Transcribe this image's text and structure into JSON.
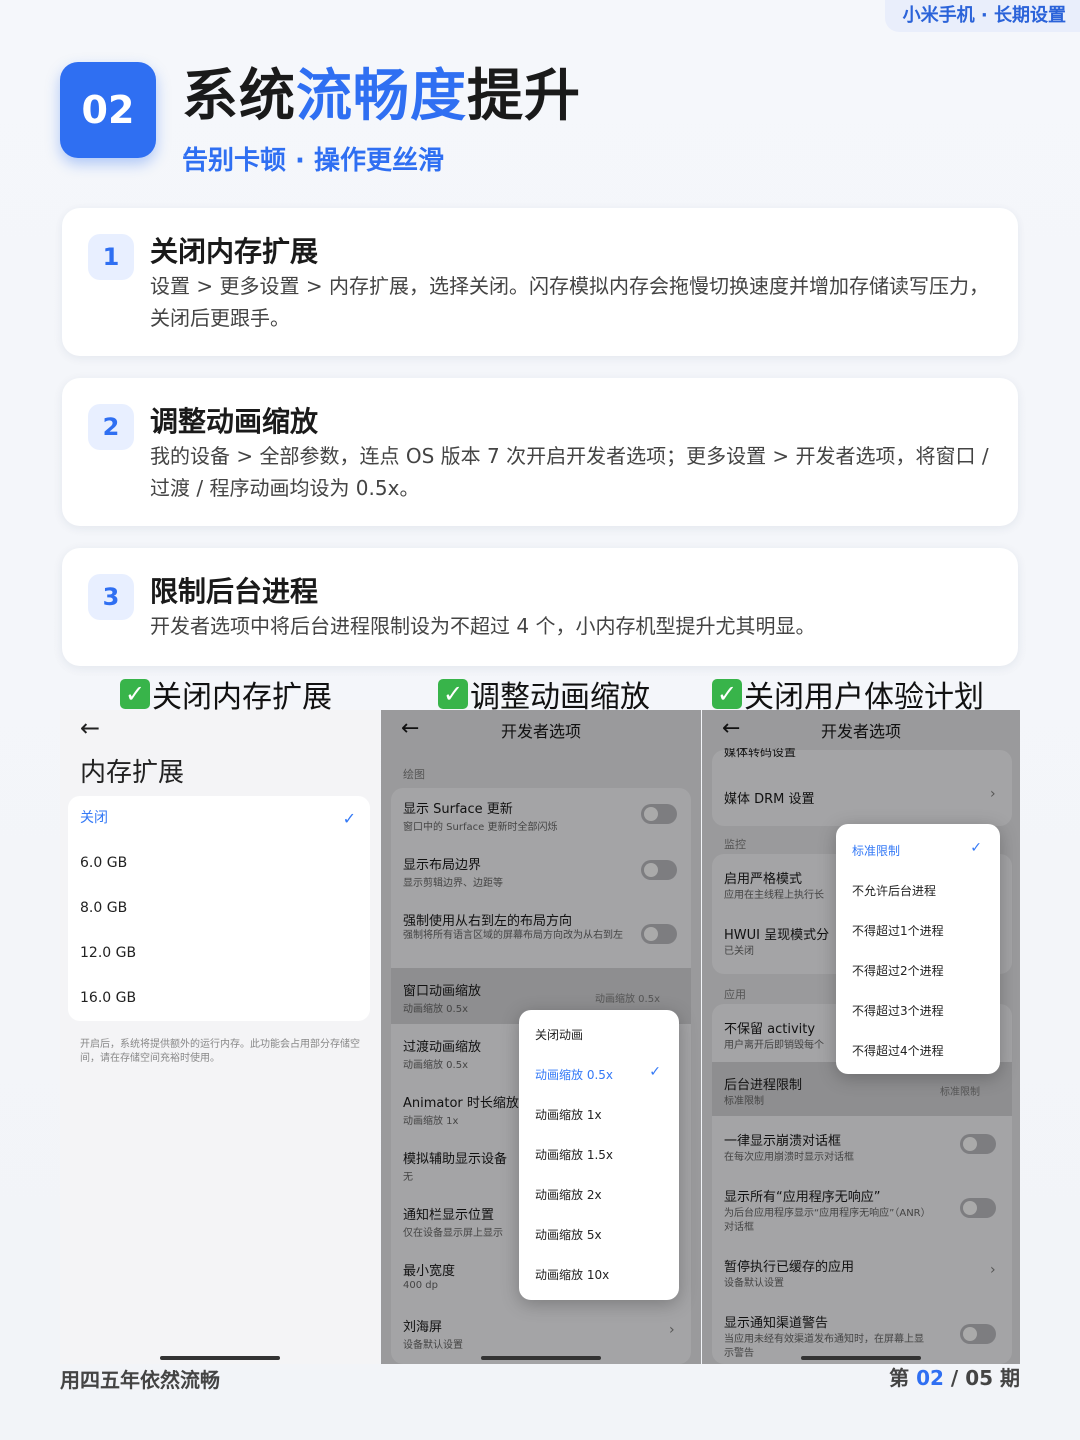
{
  "header": {
    "tag": "小米手机 · 长期设置",
    "badge": "02",
    "title_a": "系统",
    "title_hl": "流畅度",
    "title_b": "提升",
    "subtitle": "告别卡顿 · 操作更丝滑"
  },
  "steps": [
    {
      "num": "1",
      "title": "关闭内存扩展",
      "desc": "设置 > 更多设置 > 内存扩展，选择关闭。闪存模拟内存会拖慢切换速度并增加存储读写压力，关闭后更跟手。"
    },
    {
      "num": "2",
      "title": "调整动画缩放",
      "desc": "我的设备 > 全部参数，连点 OS 版本 7 次开启开发者选项；更多设置 > 开发者选项，将窗口 / 过渡 / 程序动画均设为 0.5x。"
    },
    {
      "num": "3",
      "title": "限制后台进程",
      "desc": "开发者选项中将后台进程限制设为不超过 4 个，小内存机型提升尤其明显。"
    }
  ],
  "captions": [
    "关闭内存扩展",
    "调整动画缩放",
    "关闭用户体验计划"
  ],
  "shot1": {
    "back": "←",
    "title": "内存扩展",
    "options": [
      "关闭",
      "6.0 GB",
      "8.0 GB",
      "12.0 GB",
      "16.0 GB"
    ],
    "note": "开启后，系统将提供额外的运行内存。此功能会占用部分存储空间，请在存储空间充裕时使用。"
  },
  "shot2": {
    "back": "←",
    "title": "开发者选项",
    "section": "绘图",
    "rows": [
      {
        "t": "显示 Surface 更新",
        "s": "窗口中的 Surface 更新时全部闪烁"
      },
      {
        "t": "显示布局边界",
        "s": "显示剪辑边界、边距等"
      },
      {
        "t": "强制使用从右到左的布局方向",
        "s": "强制将所有语言区域的屏幕布局方向改为从右到左"
      },
      {
        "t": "窗口动画缩放",
        "s": "动画缩放 0.5x",
        "v": "动画缩放 0.5x"
      },
      {
        "t": "过渡动画缩放",
        "s": "动画缩放 0.5x"
      },
      {
        "t": "Animator 时长缩放",
        "s": "动画缩放 1x"
      },
      {
        "t": "模拟辅助显示设备",
        "s": "无"
      },
      {
        "t": "通知栏显示位置",
        "s": "仅在设备显示屏上显示"
      },
      {
        "t": "最小宽度",
        "s": "400 dp"
      },
      {
        "t": "刘海屏",
        "s": "设备默认设置"
      }
    ],
    "popup": [
      "关闭动画",
      "动画缩放 0.5x",
      "动画缩放 1x",
      "动画缩放 1.5x",
      "动画缩放 2x",
      "动画缩放 5x",
      "动画缩放 10x"
    ]
  },
  "shot3": {
    "back": "←",
    "title": "开发者选项",
    "rows": [
      {
        "t": "媒体转码设置"
      },
      {
        "t": "媒体 DRM 设置"
      },
      {
        "t": "启用严格模式",
        "s": "应用在主线程上执行长"
      },
      {
        "t": "HWUI 呈现模式分",
        "s": "已关闭"
      },
      {
        "t": "不保留 activity",
        "s": "用户离开后即销毁每个"
      },
      {
        "t": "后台进程限制",
        "s": "标准限制",
        "v": "标准限制"
      },
      {
        "t": "一律显示崩溃对话框",
        "s": "在每次应用崩溃时显示对话框"
      },
      {
        "t": "显示所有“应用程序无响应”",
        "s": "为后台应用程序显示“应用程序无响应”（ANR）",
        "s2": "对话框"
      },
      {
        "t": "暂停执行已缓存的应用",
        "s": "设备默认设置"
      },
      {
        "t": "显示通知渠道警告",
        "s": "当应用未经有效渠道发布通知时，在屏幕上显",
        "s2": "示警告"
      }
    ],
    "sec_monitor": "监控",
    "sec_app": "应用",
    "popup": [
      "标准限制",
      "不允许后台进程",
      "不得超过1个进程",
      "不得超过2个进程",
      "不得超过3个进程",
      "不得超过4个进程"
    ]
  },
  "footer": {
    "left": "用四五年依然流畅",
    "prefix": "第 ",
    "page": "02",
    "suffix": " / 05 期"
  }
}
